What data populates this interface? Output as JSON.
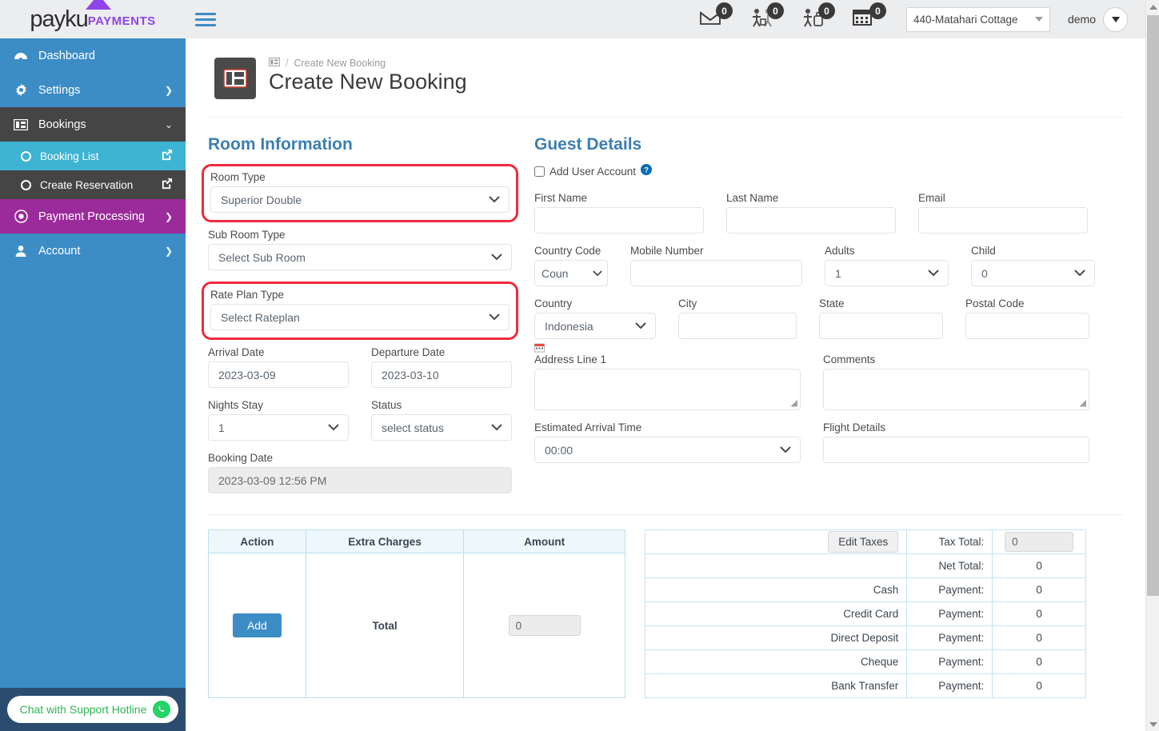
{
  "brand": {
    "name": "payku",
    "suffix": "PAYMENTS"
  },
  "topbar": {
    "menu_icon": "hamburger-icon",
    "notifications": [
      {
        "icon": "mail-icon",
        "count": "0"
      },
      {
        "icon": "check-in-icon",
        "count": "0"
      },
      {
        "icon": "check-out-icon",
        "count": "0"
      },
      {
        "icon": "calendar-icon",
        "count": "0"
      }
    ],
    "property": "440-Matahari Cottage",
    "user": "demo"
  },
  "sidebar": {
    "items": [
      {
        "label": "Dashboard",
        "icon": "dashboard-icon",
        "chevron": ""
      },
      {
        "label": "Settings",
        "icon": "gear-icon",
        "chevron": "❯"
      },
      {
        "label": "Bookings",
        "icon": "bookings-icon",
        "chevron": "⌄"
      },
      {
        "label": "Payment Processing",
        "icon": "target-icon",
        "chevron": "❯"
      },
      {
        "label": "Account",
        "icon": "user-icon",
        "chevron": "❯"
      }
    ],
    "subitems": [
      {
        "label": "Booking List",
        "icon": "external-link-icon"
      },
      {
        "label": "Create Reservation",
        "icon": "external-link-icon"
      }
    ],
    "chat": {
      "label": "Chat with Support Hotline",
      "icon": "whatsapp-icon"
    }
  },
  "header": {
    "breadcrumb_icon": "bookings-icon",
    "breadcrumb_sep": "/",
    "breadcrumb": "Create New Booking",
    "title": "Create New Booking"
  },
  "room": {
    "section_title": "Room Information",
    "room_type_label": "Room Type",
    "room_type_value": "Superior Double",
    "sub_room_label": "Sub Room Type",
    "sub_room_value": "Select Sub Room",
    "rate_plan_label": "Rate Plan Type",
    "rate_plan_value": "Select Rateplan",
    "arrival_label": "Arrival Date",
    "arrival_value": "2023-03-09",
    "departure_label": "Departure Date",
    "departure_value": "2023-03-10",
    "nights_label": "Nights Stay",
    "nights_value": "1",
    "status_label": "Status",
    "status_value": "select status",
    "booking_date_label": "Booking Date",
    "booking_date_value": "2023-03-09 12:56 PM"
  },
  "guest": {
    "section_title": "Guest Details",
    "add_user_label": "Add User Account",
    "help_icon": "help-circle-icon",
    "first_name_label": "First Name",
    "first_name_value": "",
    "last_name_label": "Last Name",
    "last_name_value": "",
    "email_label": "Email",
    "email_value": "",
    "country_code_label": "Country Code",
    "country_code_value": "Coun",
    "mobile_label": "Mobile Number",
    "mobile_value": "",
    "adults_label": "Adults",
    "adults_value": "1",
    "child_label": "Child",
    "child_value": "0",
    "country_label": "Country",
    "country_value": "Indonesia",
    "city_label": "City",
    "city_value": "",
    "state_label": "State",
    "state_value": "",
    "postal_label": "Postal Code",
    "postal_value": "",
    "address_label": "Address Line 1",
    "address_value": "",
    "address_icon": "calendar-red-icon",
    "comments_label": "Comments",
    "comments_value": "",
    "eta_label": "Estimated Arrival Time",
    "eta_value": "00:00",
    "flight_label": "Flight Details",
    "flight_value": ""
  },
  "charges_table": {
    "headers": [
      "Action",
      "Extra Charges",
      "Amount"
    ],
    "add_label": "Add",
    "total_label": "Total",
    "total_value": "0"
  },
  "payments_table": {
    "edit_taxes_label": "Edit Taxes",
    "tax_total_label": "Tax Total:",
    "tax_total_value": "0",
    "net_total_label": "Net Total:",
    "net_total_value": "0",
    "rows": [
      {
        "method": "Cash",
        "kind": "Payment:",
        "value": "0"
      },
      {
        "method": "Credit Card",
        "kind": "Payment:",
        "value": "0"
      },
      {
        "method": "Direct Deposit",
        "kind": "Payment:",
        "value": "0"
      },
      {
        "method": "Cheque",
        "kind": "Payment:",
        "value": "0"
      },
      {
        "method": "Bank Transfer",
        "kind": "Payment:",
        "value": "0"
      }
    ]
  },
  "colors": {
    "sidebar": "#3c8dc5",
    "sidebar_sub": "#3eb3d2",
    "active": "#454545",
    "purple": "#9b2b9b",
    "accent": "#3c7fb1",
    "highlight": "#ee2b3c",
    "whatsapp": "#25D366"
  }
}
